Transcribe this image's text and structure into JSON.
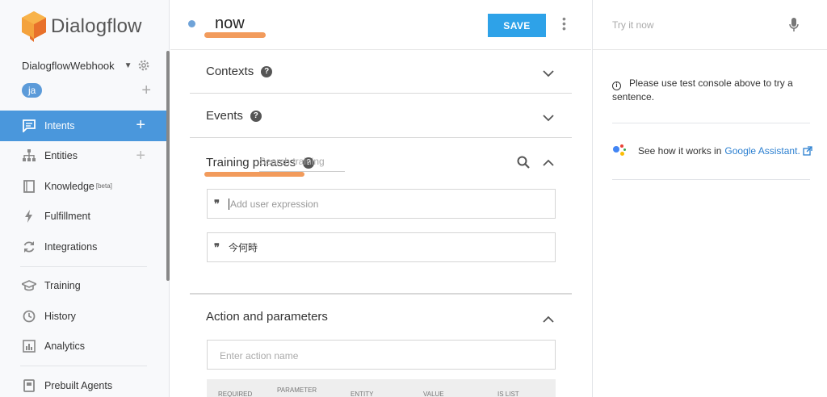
{
  "app": {
    "name": "Dialogflow"
  },
  "agent": {
    "name": "DialogflowWebhook",
    "language": "ja"
  },
  "nav": {
    "items": [
      {
        "label": "Intents",
        "icon": "chat-icon",
        "active": true
      },
      {
        "label": "Entities",
        "icon": "hierarchy-icon"
      },
      {
        "label": "Knowledge",
        "badge": "[beta]",
        "icon": "book-icon"
      },
      {
        "label": "Fulfillment",
        "icon": "bolt-icon"
      },
      {
        "label": "Integrations",
        "icon": "sync-icon"
      },
      {
        "label": "Training",
        "icon": "graduation-cap-icon"
      },
      {
        "label": "History",
        "icon": "clock-icon"
      },
      {
        "label": "Analytics",
        "icon": "bar-chart-icon"
      },
      {
        "label": "Prebuilt Agents",
        "icon": "agent-icon"
      }
    ]
  },
  "intent": {
    "name": "now",
    "save_label": "SAVE"
  },
  "sections": {
    "contexts": "Contexts",
    "events": "Events",
    "training": "Training phrases",
    "training_search_placeholder": "Search training",
    "add_expression_placeholder": "Add user expression",
    "phrases": [
      "今何時"
    ],
    "action": "Action and parameters",
    "action_placeholder": "Enter action name",
    "param_headers": [
      "REQUIRED",
      "PARAMETER",
      "ENTITY",
      "VALUE",
      "IS LIST"
    ]
  },
  "console": {
    "try_placeholder": "Try it now",
    "info_text": "Please use test console above to try a sentence.",
    "ga_prefix": "See how it works in",
    "ga_link": "Google Assistant.",
    "help_icon_glyph": "?",
    "info_icon_glyph": "i"
  },
  "colors": {
    "accent": "#4a97dc",
    "save": "#2ea2e8",
    "highlight": "#f29b5c"
  }
}
